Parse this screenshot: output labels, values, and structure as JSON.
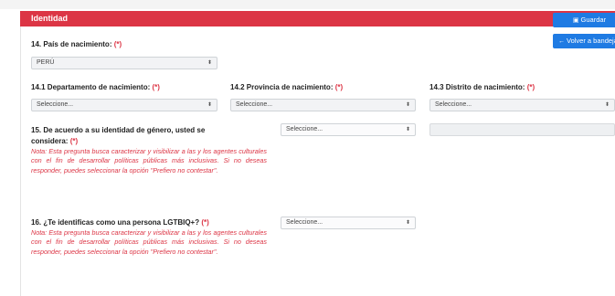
{
  "panel": {
    "title": "Identidad"
  },
  "buttons": {
    "guardar": {
      "label": "Guardar"
    },
    "volver": {
      "label": "Volver a bandeja"
    }
  },
  "q14": {
    "label": "14. País de nacimiento:",
    "required": "(*)",
    "value": "PERÚ"
  },
  "q14_1": {
    "label": "14.1 Departamento de nacimiento:",
    "required": "(*)",
    "value": "Seleccione..."
  },
  "q14_2": {
    "label": "14.2 Provincia de nacimiento:",
    "required": "(*)",
    "value": "Seleccione..."
  },
  "q14_3": {
    "label": "14.3 Distrito de nacimiento:",
    "required": "(*)",
    "value": "Seleccione..."
  },
  "q15": {
    "label_line1": "15. De acuerdo a su identidad de género, usted se",
    "label_line2": "considera:",
    "required": "(*)",
    "note": "Nota: Esta pregunta busca caracterizar y visibilizar a las y los agentes culturales con el fin de desarrollar políticas públicas más inclusivas. Si no deseas responder, puedes seleccionar la opción \"Prefiero no contestar\".",
    "value": "Seleccione...",
    "other_value": ""
  },
  "q16": {
    "label": "16. ¿Te identificas como una persona LGTBIQ+?",
    "required": "(*)",
    "note": "Nota: Esta pregunta busca caracterizar y visibilizar a las y los agentes culturales con el fin de desarrollar políticas públicas más inclusivas. Si no deseas responder, puedes seleccionar la opción \"Prefiero no contestar\".",
    "value": "Seleccione..."
  },
  "icons": {
    "save": "floppy-disk-icon",
    "back": "arrow-left-icon",
    "dropdown": "updown-chevron-icon"
  },
  "colors": {
    "header": "#dc3545",
    "primary_button": "#1f7be3",
    "required": "#dc3545"
  }
}
